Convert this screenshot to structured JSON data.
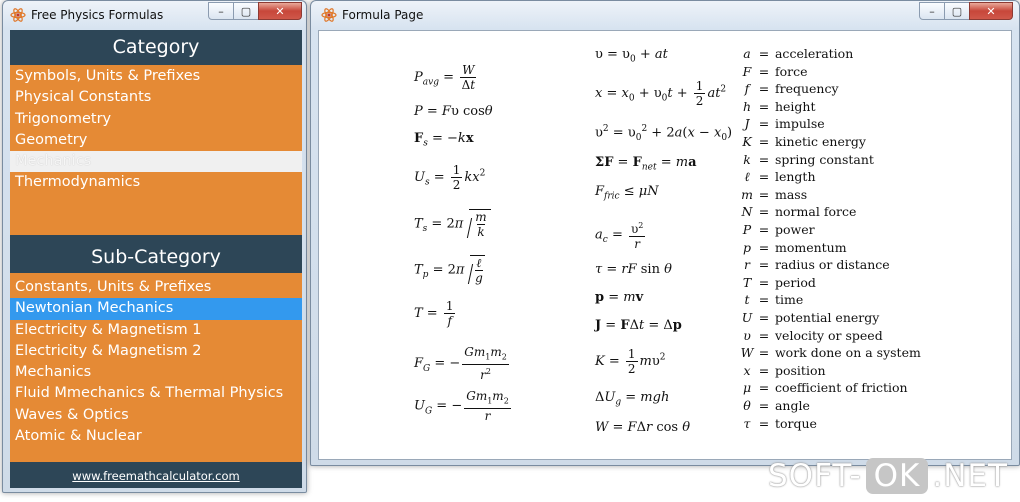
{
  "left_window": {
    "title": "Free Physics Formulas",
    "category_header": "Category",
    "categories": [
      "Symbols, Units & Prefixes",
      "Physical Constants",
      "Trigonometry",
      "Geometry",
      "Mechanics",
      "Thermodynamics"
    ],
    "selected_category": "Mechanics",
    "subcategory_header": "Sub-Category",
    "subcategories": [
      "Constants, Units & Prefixes",
      "Newtonian Mechanics",
      "Electricity & Magnetism 1",
      "Electricity & Magnetism 2",
      "Mechanics",
      "Fluid Mmechanics & Thermal Physics",
      "Waves & Optics",
      "Atomic & Nuclear"
    ],
    "selected_subcategory": "Newtonian Mechanics",
    "footer_link": "www.freemathcalculator.com"
  },
  "right_window": {
    "title": "Formula Page"
  },
  "legend": [
    {
      "sym": "a",
      "desc": "acceleration"
    },
    {
      "sym": "F",
      "desc": "force"
    },
    {
      "sym": "f",
      "desc": "frequency"
    },
    {
      "sym": "h",
      "desc": "height"
    },
    {
      "sym": "J",
      "desc": "impulse"
    },
    {
      "sym": "K",
      "desc": "kinetic energy"
    },
    {
      "sym": "k",
      "desc": "spring constant"
    },
    {
      "sym": "ℓ",
      "desc": "length"
    },
    {
      "sym": "m",
      "desc": "mass"
    },
    {
      "sym": "N",
      "desc": "normal force"
    },
    {
      "sym": "P",
      "desc": "power"
    },
    {
      "sym": "p",
      "desc": "momentum"
    },
    {
      "sym": "r",
      "desc": "radius or distance"
    },
    {
      "sym": "T",
      "desc": "period"
    },
    {
      "sym": "t",
      "desc": "time"
    },
    {
      "sym": "U",
      "desc": "potential energy"
    },
    {
      "sym": "υ",
      "desc": "velocity or speed"
    },
    {
      "sym": "W",
      "desc": "work done on a system"
    },
    {
      "sym": "x",
      "desc": "position"
    },
    {
      "sym": "μ",
      "desc": "coefficient of friction"
    },
    {
      "sym": "θ",
      "desc": "angle"
    },
    {
      "sym": "τ",
      "desc": "torque"
    }
  ],
  "window_controls": {
    "minimize": "–",
    "maximize": "▢",
    "close": "✕"
  },
  "watermark": {
    "left": "SOFT-",
    "ok": "OK",
    "right": ".NET"
  },
  "colors": {
    "category_bg": "#e58a35",
    "header_bg": "#2d4657",
    "selected_blue": "#3399ee"
  }
}
